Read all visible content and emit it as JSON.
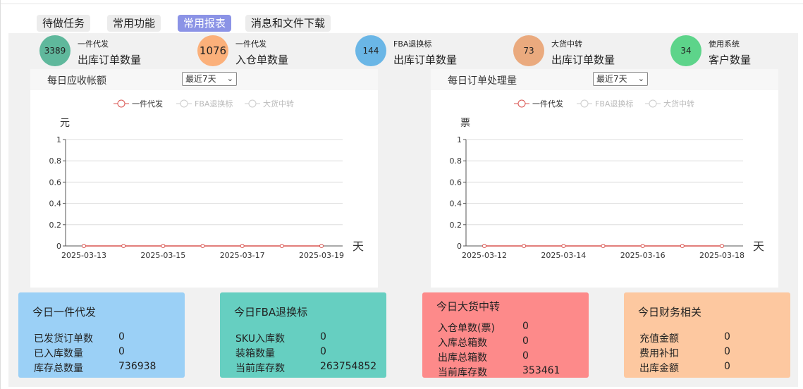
{
  "tabs": [
    "待做任务",
    "常用功能",
    "常用报表",
    "消息和文件下载"
  ],
  "active_tab": 2,
  "stats": [
    {
      "value": "3389",
      "sub": "一件代发",
      "main": "出库订单数量",
      "color": "#5fb89c"
    },
    {
      "value": "1076",
      "sub": "一件代发",
      "main": "入仓单数量",
      "color": "#fbb07a"
    },
    {
      "value": "144",
      "sub": "FBA退换标",
      "main": "出库订单数量",
      "color": "#6ab6e6"
    },
    {
      "value": "73",
      "sub": "大货中转",
      "main": "出库订单数量",
      "color": "#eaaa7e"
    },
    {
      "value": "34",
      "sub": "使用系统",
      "main": "客户数量",
      "color": "#5dd48a"
    }
  ],
  "charts": [
    {
      "title": "每日应收帐额",
      "select": "最近7天",
      "ylabel": "元",
      "xlabel": "天"
    },
    {
      "title": "每日订单处理量",
      "select": "最近7天",
      "ylabel": "票",
      "xlabel": "天"
    }
  ],
  "legend": [
    "一件代发",
    "FBA退换标",
    "大货中转"
  ],
  "chart_data": [
    {
      "type": "line",
      "title": "每日应收帐额",
      "ylabel": "元",
      "xlabel": "天",
      "x": [
        "2025-03-13",
        "2025-03-14",
        "2025-03-15",
        "2025-03-16",
        "2025-03-17",
        "2025-03-18",
        "2025-03-19"
      ],
      "x_tick_labels": [
        "2025-03-13",
        "2025-03-15",
        "2025-03-17",
        "2025-03-19"
      ],
      "ylim": [
        0,
        1
      ],
      "y_ticks": [
        "0",
        "0.2",
        "0.4",
        "0.6",
        "0.8",
        "1"
      ],
      "series": [
        {
          "name": "一件代发",
          "values": [
            0,
            0,
            0,
            0,
            0,
            0,
            0
          ],
          "color": "#d9534f"
        },
        {
          "name": "FBA退换标",
          "values": [],
          "color": "#cccccc"
        },
        {
          "name": "大货中转",
          "values": [],
          "color": "#cccccc"
        }
      ],
      "grid": true,
      "legend_position": "top"
    },
    {
      "type": "line",
      "title": "每日订单处理量",
      "ylabel": "票",
      "xlabel": "天",
      "x": [
        "2025-03-12",
        "2025-03-13",
        "2025-03-14",
        "2025-03-15",
        "2025-03-16",
        "2025-03-17",
        "2025-03-18"
      ],
      "x_tick_labels": [
        "2025-03-12",
        "2025-03-14",
        "2025-03-16",
        "2025-03-18"
      ],
      "ylim": [
        0,
        1
      ],
      "y_ticks": [
        "0",
        "0.2",
        "0.4",
        "0.6",
        "0.8",
        "1"
      ],
      "series": [
        {
          "name": "一件代发",
          "values": [
            0,
            0,
            0,
            0,
            0,
            0,
            0
          ],
          "color": "#d9534f"
        },
        {
          "name": "FBA退换标",
          "values": [],
          "color": "#cccccc"
        },
        {
          "name": "大货中转",
          "values": [],
          "color": "#cccccc"
        }
      ],
      "grid": true,
      "legend_position": "top"
    }
  ],
  "cards": [
    {
      "title": "今日一件代发",
      "color": "#9bd0f6",
      "rows": [
        [
          "已发货订单数",
          "0"
        ],
        [
          "已入库数量",
          "0"
        ],
        [
          "库存总数量",
          "736938"
        ]
      ]
    },
    {
      "title": "今日FBA退换标",
      "color": "#66cfc1",
      "rows": [
        [
          "SKU入库数",
          "0"
        ],
        [
          "装箱数量",
          "0"
        ],
        [
          "当前库存数",
          "263754852"
        ]
      ]
    },
    {
      "title": "今日大货中转",
      "color": "#fd8a8a",
      "rows": [
        [
          "入仓单数(票)",
          "0"
        ],
        [
          "入库总箱数",
          "0"
        ],
        [
          "出库总箱数",
          "0"
        ],
        [
          "当前库存数",
          "353461"
        ]
      ]
    },
    {
      "title": "今日财务相关",
      "color": "#fdc8a0",
      "rows": [
        [
          "充值金额",
          "0"
        ],
        [
          "费用补扣",
          "0"
        ],
        [
          "出库金额",
          "0"
        ]
      ]
    }
  ]
}
